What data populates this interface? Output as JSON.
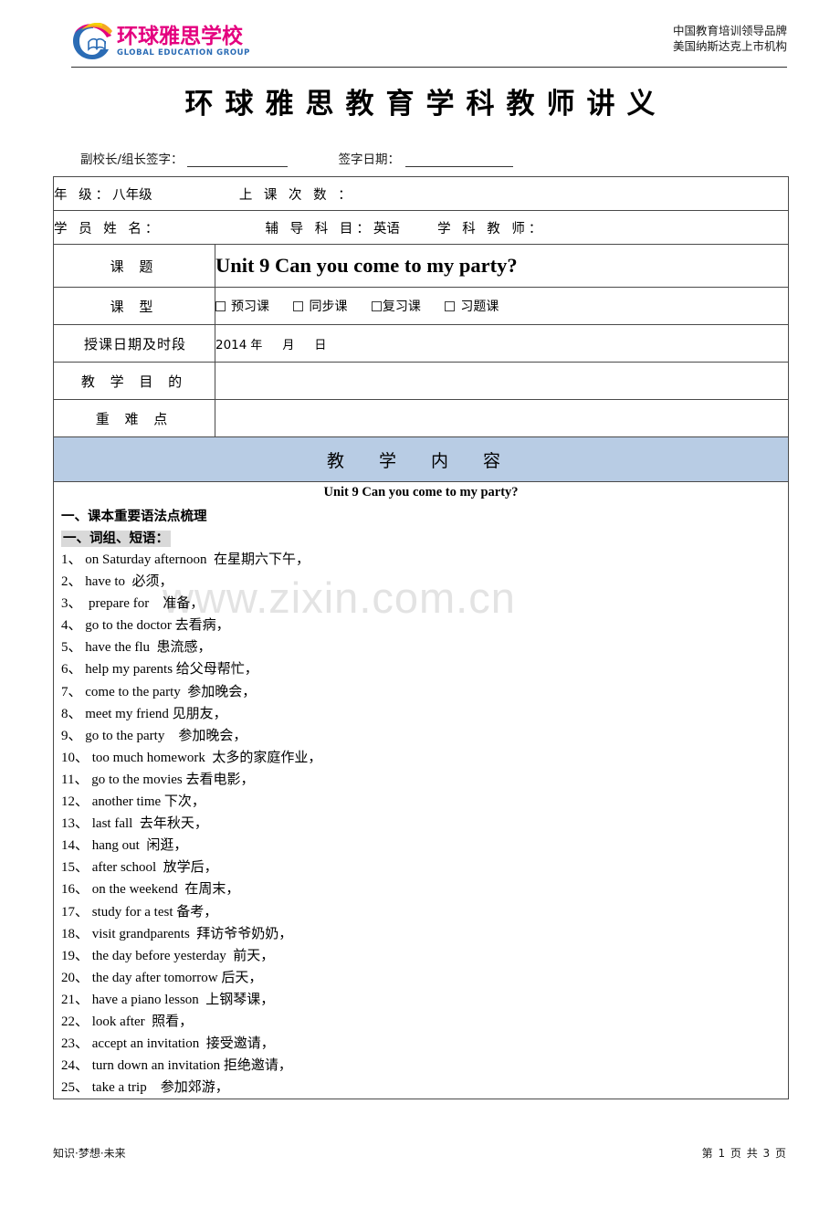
{
  "masthead": {
    "logo_cn": "环球雅思学校",
    "logo_en": "GLOBAL EDUCATION GROUP",
    "tagline_1": "中国教育培训领导品牌",
    "tagline_2": "美国纳斯达克上市机构"
  },
  "doc_title": "环球雅思教育学科教师讲义",
  "signature": {
    "signer_label": "副校长/组长签字：",
    "date_label": "签字日期：",
    "signer_value": "",
    "date_value": ""
  },
  "info": {
    "grade_label": "年       级：",
    "grade_value": "八年级",
    "sessions_label": "上 课 次 数 ：",
    "sessions_value": "",
    "student_label": "学 员 姓 名：",
    "student_value": "",
    "subject_label": "辅 导 科 目：",
    "subject_value": "英语",
    "teacher_label": "学 科 教 师：",
    "teacher_value": ""
  },
  "rows": {
    "topic_label": "课    题",
    "topic_value": "Unit 9 Can you come to my party?",
    "type_label": "课    型",
    "type_options": [
      "预习课",
      "同步课",
      "复习课",
      "习题课"
    ],
    "date_label": "授课日期及时段",
    "date_year": "2014",
    "date_year_unit": "年",
    "date_month_unit": "月",
    "date_day_unit": "日",
    "aim_label": "教 学 目 的",
    "aim_value": "",
    "key_label": "重 难 点",
    "key_value": ""
  },
  "section_bar": "教    学    内    容",
  "content": {
    "unit_heading": "Unit 9 Can you come to my party?",
    "heading_1": "一、课本重要语法点梳理",
    "heading_2": "一、词组、短语：",
    "phrases": [
      "1、 on Saturday afternoon  在星期六下午，",
      "2、 have to  必须，",
      "3、  prepare for    准备，",
      "4、 go to the doctor 去看病，",
      "5、 have the flu  患流感，",
      "6、 help my parents 给父母帮忙，",
      "7、 come to the party  参加晚会，",
      "8、 meet my friend 见朋友，",
      "9、 go to the party    参加晚会，",
      "10、 too much homework  太多的家庭作业，",
      "11、 go to the movies 去看电影，",
      "12、 another time 下次，",
      "13、 last fall  去年秋天，",
      "14、 hang out  闲逛，",
      "15、 after school  放学后，",
      "16、 on the weekend  在周末，",
      "17、 study for a test 备考，",
      "18、 visit grandparents  拜访爷爷奶奶，",
      "19、 the day before yesterday  前天，",
      "20、 the day after tomorrow 后天，",
      "21、 have a piano lesson  上钢琴课，",
      "22、 look after  照看，",
      "23、 accept an invitation  接受邀请，",
      "24、 turn down an invitation 拒绝邀请，",
      "25、 take a trip    参加郊游，"
    ]
  },
  "watermark": "www.zixin.com.cn",
  "footer": {
    "slogan": "知识·梦想·未来",
    "page_info": "第 1 页  共 3 页"
  },
  "colors": {
    "section_bar_bg": "#b8cce4",
    "logo_pink": "#e4007f",
    "logo_blue": "#2b6cb5",
    "watermark": "#e3e3e3"
  }
}
